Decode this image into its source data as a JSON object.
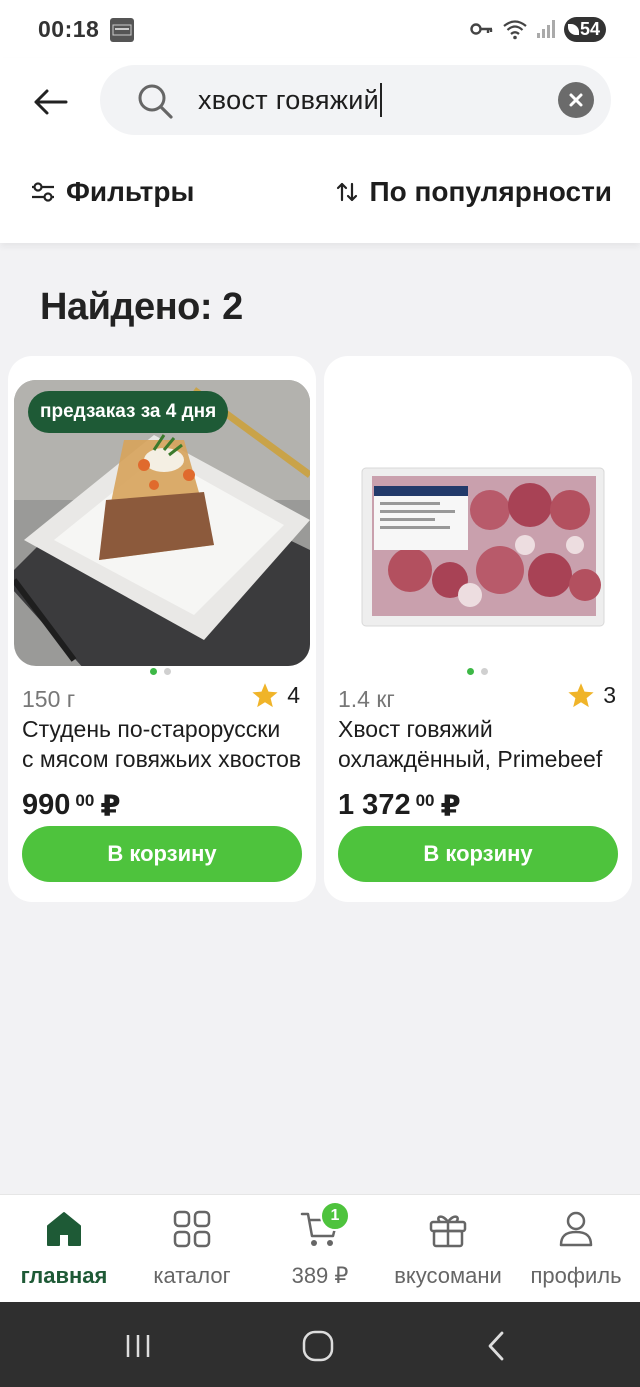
{
  "status_bar": {
    "time": "00:18",
    "notification_icon": "app-notification-icon",
    "battery": "54"
  },
  "search": {
    "query": "хвост говяжий",
    "back_icon": "arrow-left-icon",
    "clear_icon": "close-circle-icon"
  },
  "toolbar": {
    "filters_label": "Фильтры",
    "sort_label": "По популярности"
  },
  "results": {
    "found_label": "Найдено: 2"
  },
  "products": [
    {
      "badge": "предзаказ за 4 дня",
      "weight": "150 г",
      "rating": "4",
      "title_line1": "Студень по-старорусски",
      "title_line2": "с мясом говяжьих хвостов",
      "price_main": "990",
      "price_cents": "00",
      "currency": "₽",
      "cart_label": "В корзину"
    },
    {
      "weight": "1.4 кг",
      "rating": "3",
      "title_line1": "Хвост говяжий",
      "title_line2": "охлаждённый, Primebeef",
      "price_main": "1 372",
      "price_cents": "00",
      "currency": "₽",
      "cart_label": "В корзину"
    }
  ],
  "bottom_nav": {
    "items": [
      {
        "label": "главная",
        "icon": "home-icon"
      },
      {
        "label": "каталог",
        "icon": "grid-icon"
      },
      {
        "label": "389 ₽",
        "icon": "cart-icon",
        "badge": "1"
      },
      {
        "label": "вкусомани",
        "icon": "gift-icon"
      },
      {
        "label": "профиль",
        "icon": "user-icon"
      }
    ]
  },
  "colors": {
    "accent_green": "#4ec33d",
    "dark_green": "#1e5a36",
    "background": "#f2f2f4"
  }
}
